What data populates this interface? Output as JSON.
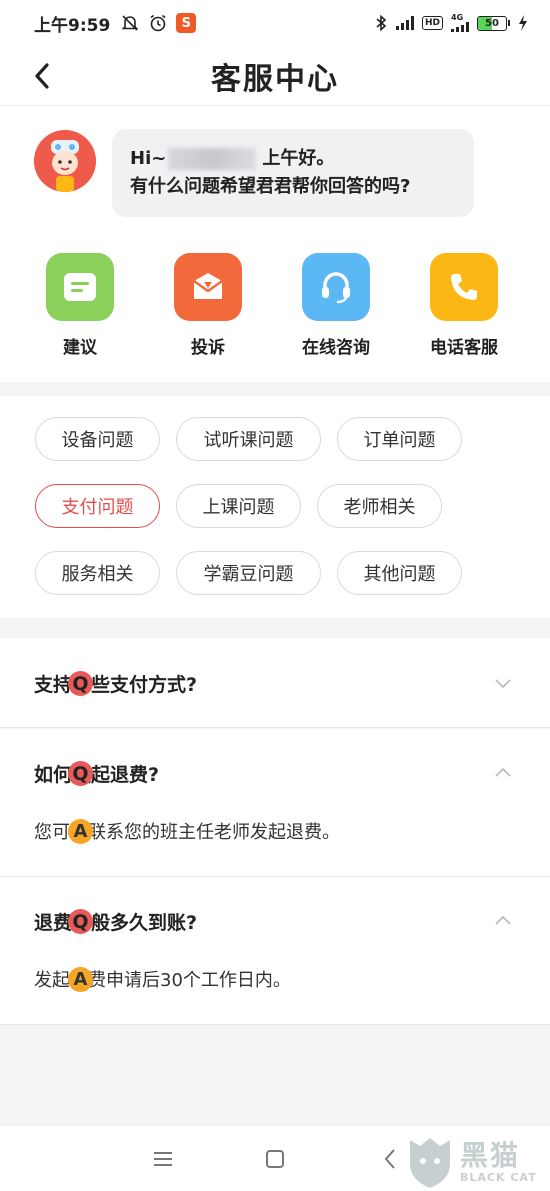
{
  "status_bar": {
    "time": "上午9:59",
    "app_badge": "S",
    "network_type": "4G",
    "hd_label": "HD",
    "battery_level": "50",
    "battery_fraction": 0.5
  },
  "header": {
    "title": "客服中心"
  },
  "greeting": {
    "prefix": "Hi~",
    "suffix": "上午好。",
    "line2": "有什么问题希望君君帮你回答的吗?"
  },
  "actions": [
    {
      "label": "建议",
      "icon": "suggestion-icon",
      "color": "#8bd05a"
    },
    {
      "label": "投诉",
      "icon": "complaint-icon",
      "color": "#f26a3c"
    },
    {
      "label": "在线咨询",
      "icon": "headset-icon",
      "color": "#5bb8f5"
    },
    {
      "label": "电话客服",
      "icon": "phone-icon",
      "color": "#fbb814"
    }
  ],
  "categories": [
    {
      "label": "设备问题",
      "active": false
    },
    {
      "label": "试听课问题",
      "active": false
    },
    {
      "label": "订单问题",
      "active": false
    },
    {
      "label": "支付问题",
      "active": true
    },
    {
      "label": "上课问题",
      "active": false
    },
    {
      "label": "老师相关",
      "active": false
    },
    {
      "label": "服务相关",
      "active": false
    },
    {
      "label": "学霸豆问题",
      "active": false
    },
    {
      "label": "其他问题",
      "active": false
    }
  ],
  "faq": [
    {
      "q_badge": "Q",
      "question": "支持哪些支付方式?",
      "expanded": false
    },
    {
      "q_badge": "Q",
      "question": "如何发起退费?",
      "expanded": true,
      "a_badge": "A",
      "answer": "您可以联系您的班主任老师发起退费。"
    },
    {
      "q_badge": "Q",
      "question": "退费一般多久到账?",
      "expanded": true,
      "a_badge": "A",
      "answer": "发起退费申请后30个工作日内。"
    }
  ],
  "watermark": {
    "cn": "黑猫",
    "en": "BLACK CAT"
  },
  "colors": {
    "accent_red": "#e54c4c",
    "answer_badge": "#f6a623"
  }
}
